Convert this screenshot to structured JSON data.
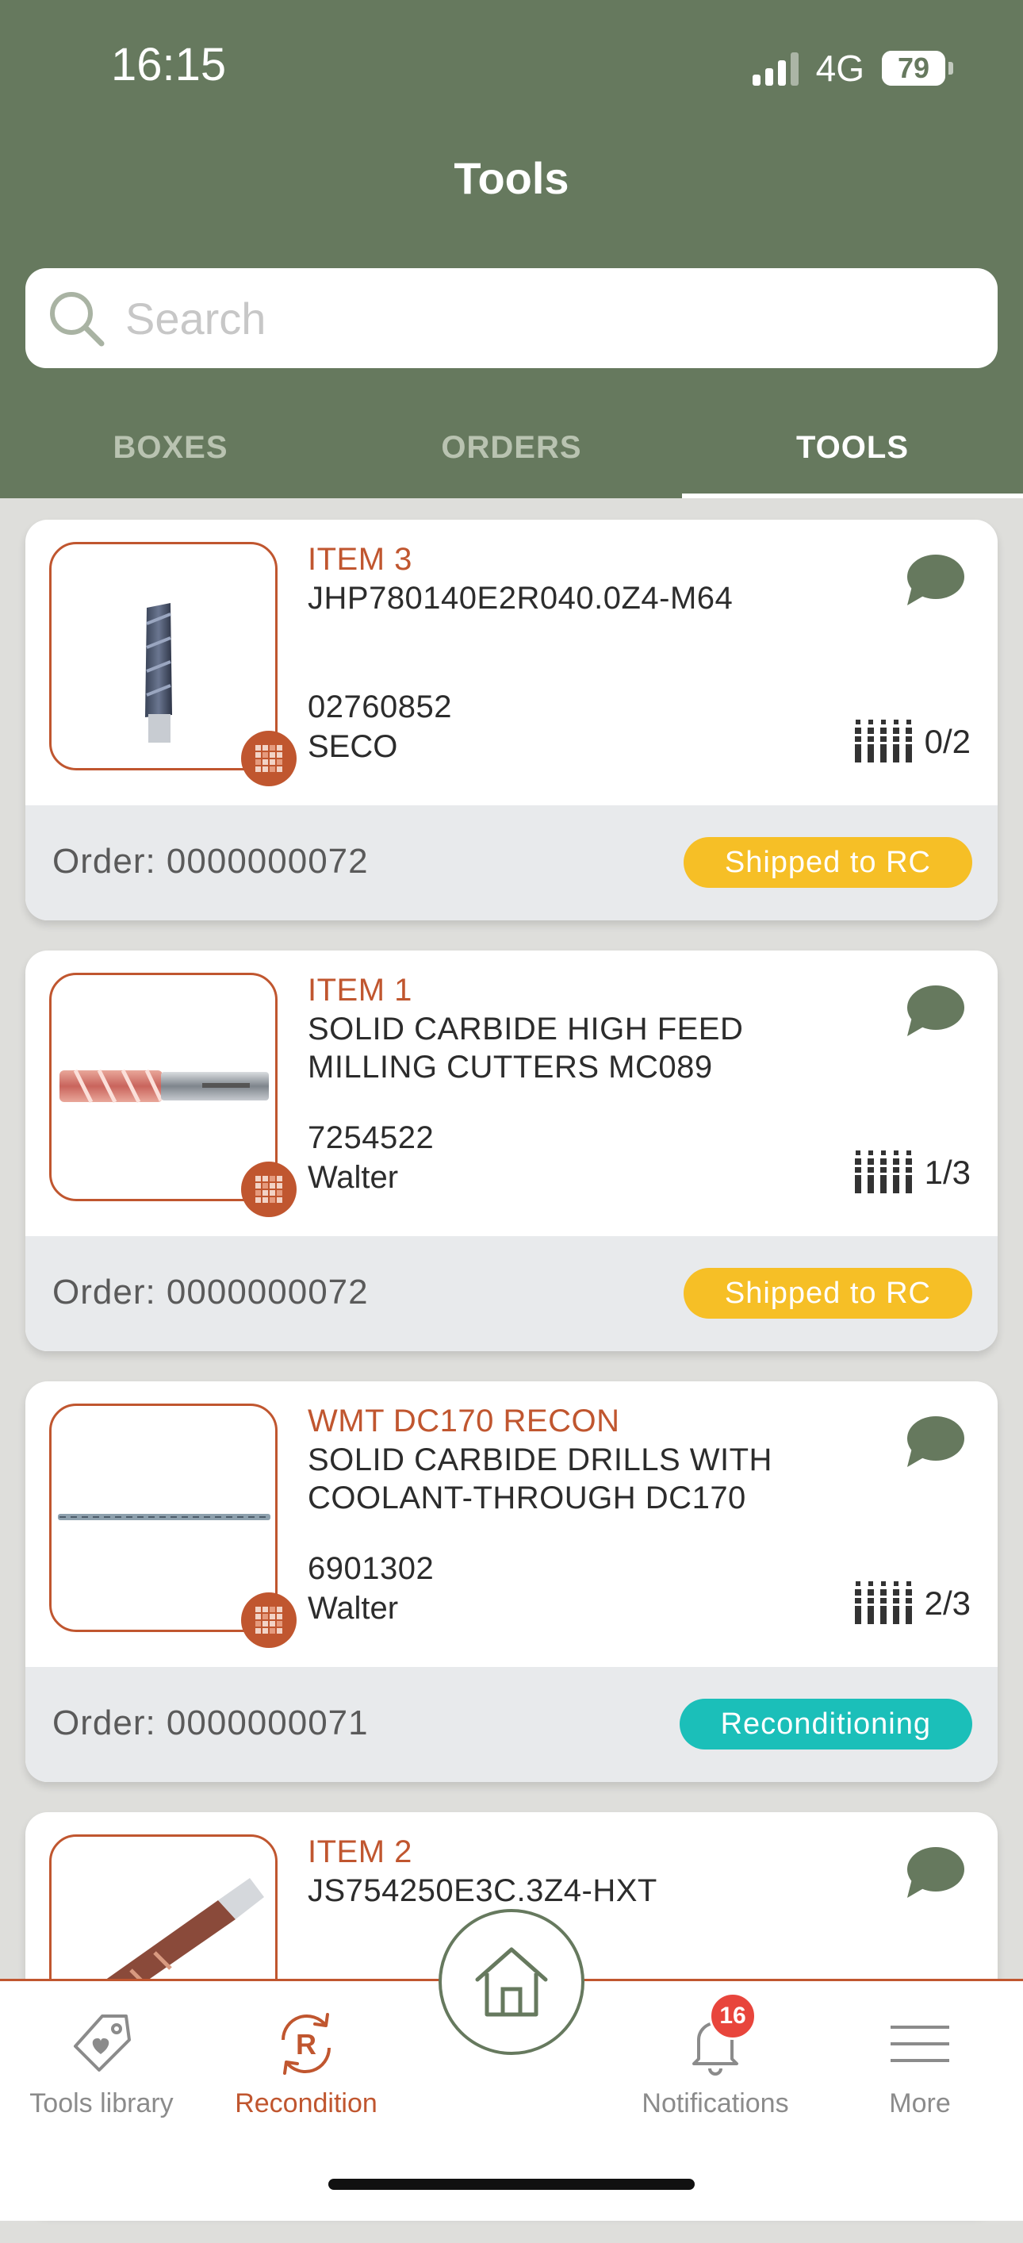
{
  "status_bar": {
    "time": "16:15",
    "network": "4G",
    "battery": "79"
  },
  "header": {
    "title": "Tools"
  },
  "search": {
    "placeholder": "Search"
  },
  "tabs": [
    {
      "label": "BOXES",
      "active": false
    },
    {
      "label": "ORDERS",
      "active": false
    },
    {
      "label": "TOOLS",
      "active": true
    }
  ],
  "cards": [
    {
      "label": "ITEM 3",
      "description": "JHP780140E2R040.0Z4-M64",
      "code": "02760852",
      "brand": "SECO",
      "count": "0/2",
      "order": "Order: 0000000072",
      "status": "Shipped to RC",
      "status_color": "#f6bf26",
      "image_icon": "end-mill-icon"
    },
    {
      "label": "ITEM 1",
      "description": "SOLID CARBIDE HIGH FEED MILLING CUTTERS MC089",
      "code": "7254522",
      "brand": "Walter",
      "count": "1/3",
      "order": "Order: 0000000072",
      "status": "Shipped to RC",
      "status_color": "#f6bf26",
      "image_icon": "milling-cutter-icon"
    },
    {
      "label": "WMT DC170 RECON",
      "description": "SOLID CARBIDE DRILLS WITH COOLANT-THROUGH DC170",
      "code": "6901302",
      "brand": "Walter",
      "count": "2/3",
      "order": "Order: 0000000071",
      "status": "Reconditioning",
      "status_color": "#1bbfb9",
      "image_icon": "long-drill-icon"
    },
    {
      "label": "ITEM 2",
      "description": "JS754250E3C.3Z4-HXT",
      "image_icon": "drill-icon"
    }
  ],
  "bottom_nav": {
    "items": [
      {
        "label": "Tools library",
        "icon": "tag-heart-icon"
      },
      {
        "label": "Recondition",
        "icon": "recondition-icon",
        "active": true
      },
      {
        "label": "Notifications",
        "icon": "bell-icon",
        "badge": "16"
      },
      {
        "label": "More",
        "icon": "menu-icon"
      }
    ],
    "home_icon": "home-icon"
  },
  "colors": {
    "header": "#66795e",
    "accent": "#c0562f",
    "shipped": "#f6bf26",
    "reconditioning": "#1bbfb9"
  }
}
